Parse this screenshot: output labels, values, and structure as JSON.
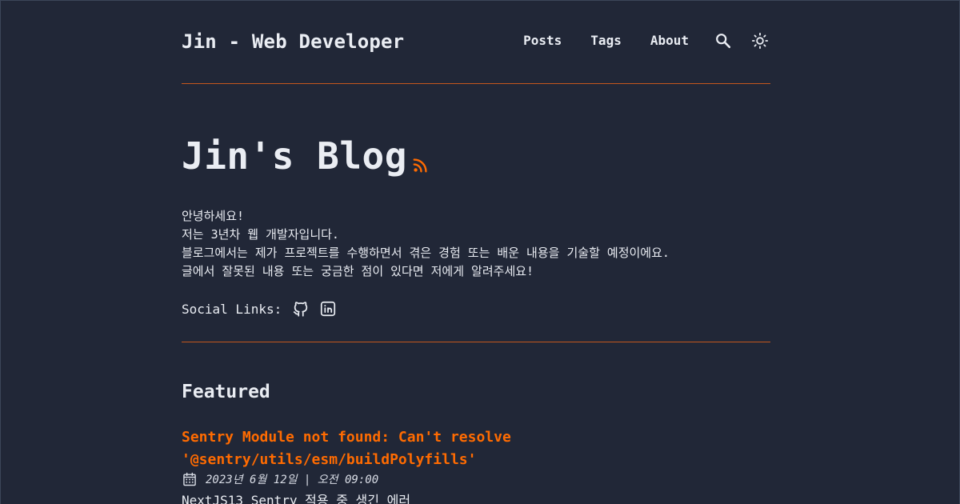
{
  "header": {
    "brand": "Jin - Web Developer",
    "nav": [
      {
        "label": "Posts"
      },
      {
        "label": "Tags"
      },
      {
        "label": "About"
      }
    ],
    "search_icon": "search-icon",
    "theme_icon": "sun-icon"
  },
  "hero": {
    "title": "Jin's Blog",
    "rss_icon": "rss-icon",
    "intro": [
      "안녕하세요!",
      "저는 3년차 웹 개발자입니다.",
      "블로그에서는 제가 프로젝트를 수행하면서 겪은 경험 또는 배운 내용을 기술할 예정이에요.",
      "글에서 잘못된 내용 또는 궁금한 점이 있다면 저에게 알려주세요!"
    ],
    "social_label": "Social Links:",
    "social_icons": [
      "github-icon",
      "linkedin-icon"
    ]
  },
  "featured": {
    "title": "Featured",
    "posts": [
      {
        "title_line1": "Sentry Module not found: Can't resolve",
        "title_line2": "'@sentry/utils/esm/buildPolyfills'",
        "date": "2023년 6월 12일 | 오전 09:00",
        "description": "NextJS13 Sentry 적용 중 생긴 에러"
      }
    ]
  },
  "colors": {
    "background": "#212737",
    "text": "#eaedf3",
    "accent": "#ff6b01",
    "divider": "#c4561d"
  }
}
